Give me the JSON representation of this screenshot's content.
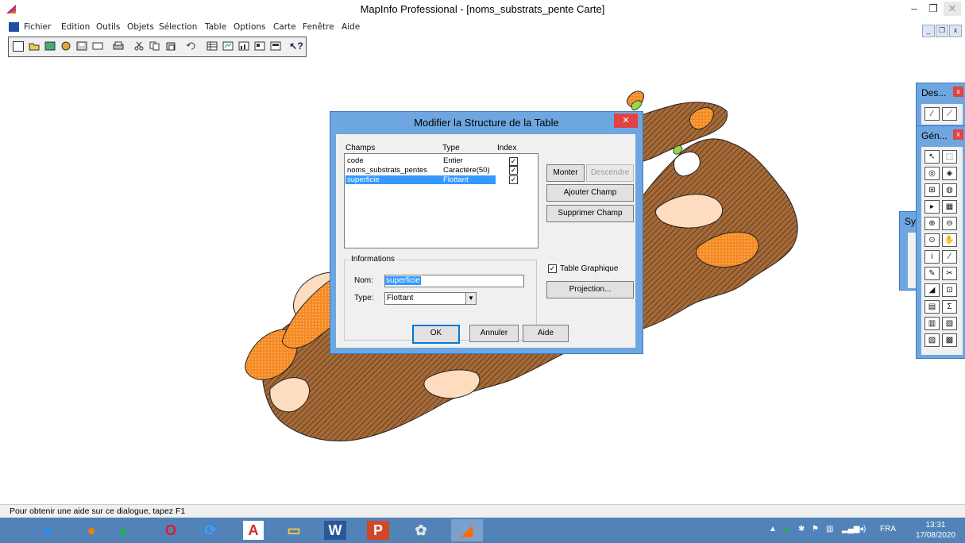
{
  "app": {
    "title": "MapInfo Professional - [noms_substrats_pente Carte]",
    "window_buttons": {
      "minimize": "–",
      "restore": "❐",
      "close": "✕"
    }
  },
  "menu": {
    "items": [
      "Fichier",
      "Edition",
      "Outils",
      "Objets",
      "Sélection",
      "Table",
      "Options",
      "Carte",
      "Fenêtre",
      "Aide"
    ],
    "mdi_buttons": [
      "_",
      "❐",
      "x"
    ]
  },
  "toolbar": {
    "icons": [
      "new-icon",
      "open-icon",
      "open-workspace-icon",
      "open-dbms-icon",
      "save-icon",
      "save-copy-icon",
      "print-icon",
      "cut-icon",
      "copy-icon",
      "paste-icon",
      "undo-icon",
      "new-browser-icon",
      "new-mapper-icon",
      "new-graph-icon",
      "new-layout-icon",
      "new-redistricter-icon",
      "help-icon"
    ]
  },
  "dialog": {
    "title": "Modifier la Structure de la Table",
    "close": "✕",
    "headers": {
      "champs": "Champs",
      "type": "Type",
      "index": "Index"
    },
    "fields": [
      {
        "name": "code",
        "type": "Entier",
        "index": true,
        "selected": false
      },
      {
        "name": "noms_substrats_pentes",
        "type": "Caractère(50)",
        "index": true,
        "selected": false
      },
      {
        "name": "superficie",
        "type": "Flottant",
        "index": true,
        "selected": true
      }
    ],
    "buttons": {
      "monter": "Monter",
      "descendre": "Descendre",
      "ajouter": "Ajouter Champ",
      "supprimer": "Supprimer Champ",
      "projection": "Projection...",
      "ok": "OK",
      "annuler": "Annuler",
      "aide": "Aide"
    },
    "info": {
      "group_title": "Informations",
      "nom_label": "Nom:",
      "nom_value": "superficie",
      "type_label": "Type:",
      "type_value": "Flottant"
    },
    "table_graphique": {
      "label": "Table Graphique",
      "checked": true
    },
    "check_glyph": "✓"
  },
  "palettes": {
    "dessin": {
      "title": "Des...",
      "close": "x"
    },
    "general": {
      "title": "Gén...",
      "close": "x"
    },
    "symbol": {
      "title": "Sy"
    },
    "tools": [
      "↖",
      "⬚",
      "◎",
      "◈",
      "⊞",
      "◍",
      "▸",
      "▦",
      "⊕",
      "⊖",
      "⊙",
      "✋",
      "i",
      "⁄",
      "✎",
      "✂",
      "◢",
      "⊡",
      "▤",
      "Σ",
      "▥",
      "▧",
      "▨",
      "▩"
    ]
  },
  "status": {
    "text": "Pour obtenir une aide sur ce dialogue, tapez F1"
  },
  "taskbar": {
    "apps": [
      {
        "name": "ie",
        "glyph": "e",
        "color": "#1e90ff"
      },
      {
        "name": "firefox",
        "glyph": "●",
        "color": "#ff7b00"
      },
      {
        "name": "arcgis",
        "glyph": "▲",
        "color": "#1db34c"
      },
      {
        "name": "opera",
        "glyph": "O",
        "color": "#e01b24"
      },
      {
        "name": "sync",
        "glyph": "⟳",
        "color": "#3aa0ff"
      },
      {
        "name": "acrobat",
        "glyph": "A",
        "color": "#d42a2a"
      },
      {
        "name": "explorer",
        "glyph": "▭",
        "color": "#f2c94c"
      },
      {
        "name": "word",
        "glyph": "W",
        "color": "#2b5797"
      },
      {
        "name": "powerpoint",
        "glyph": "P",
        "color": "#d24726"
      },
      {
        "name": "paint",
        "glyph": "✿",
        "color": "#e5e5e5"
      },
      {
        "name": "mapinfo",
        "glyph": "◢",
        "color": "#ff6a00"
      }
    ],
    "tray": {
      "lang": "FRA",
      "time": "13:31",
      "date": "17/08/2020"
    }
  }
}
